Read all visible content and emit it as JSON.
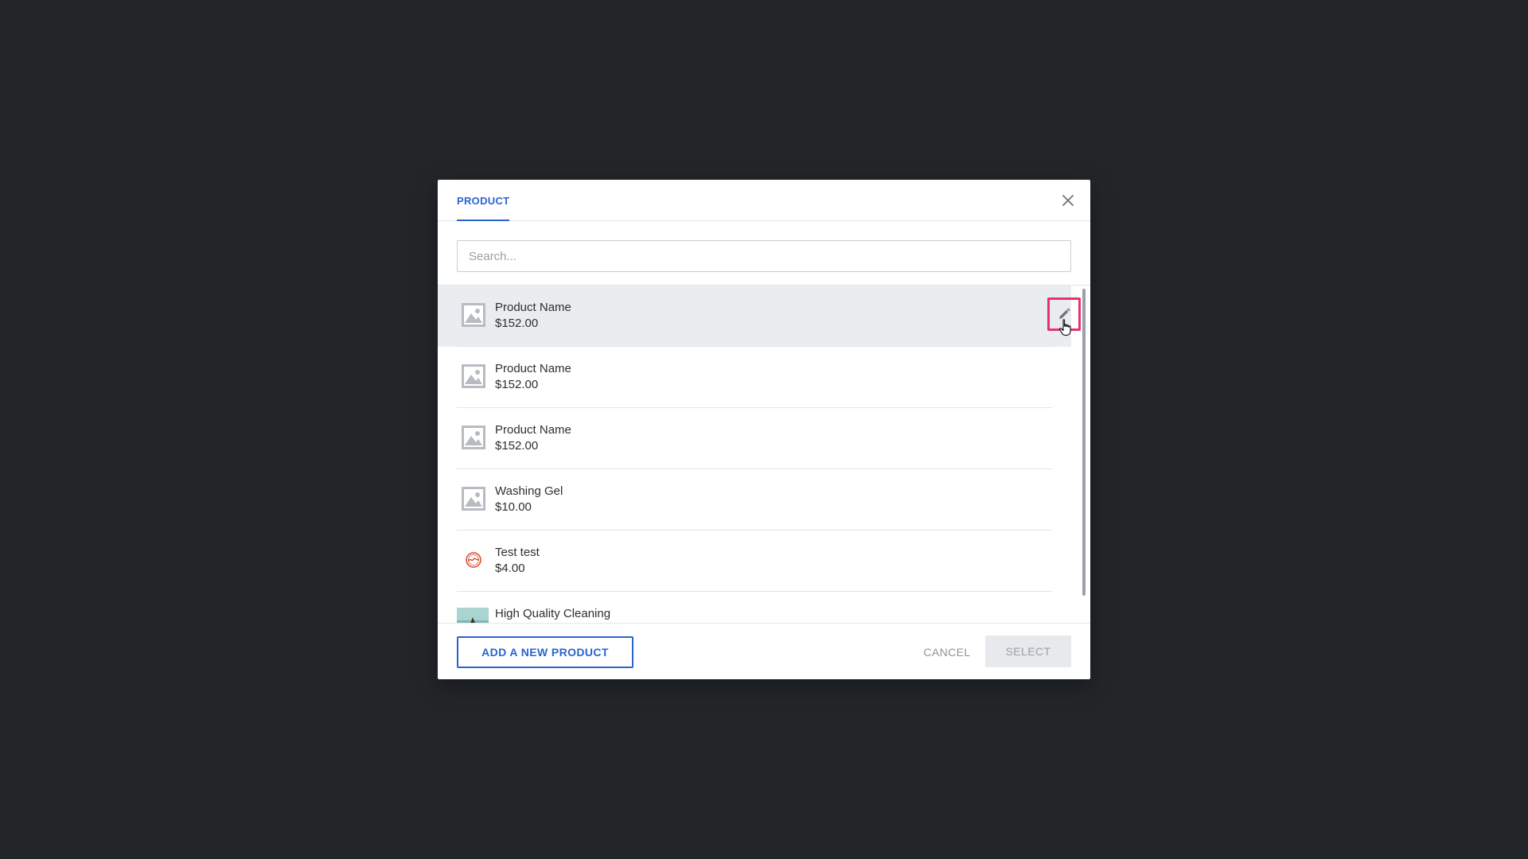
{
  "modal": {
    "tab_label": "PRODUCT",
    "search_placeholder": "Search...",
    "items": [
      {
        "name": "Product Name",
        "price": "$152.00",
        "thumb": "image-placeholder-icon"
      },
      {
        "name": "Product Name",
        "price": "$152.00",
        "thumb": "image-placeholder-icon"
      },
      {
        "name": "Product Name",
        "price": "$152.00",
        "thumb": "image-placeholder-icon"
      },
      {
        "name": "Washing Gel",
        "price": "$10.00",
        "thumb": "image-placeholder-icon"
      },
      {
        "name": "Test test",
        "price": "$4.00",
        "thumb": "logo-stamp-icon"
      },
      {
        "name": "High Quality Cleaning",
        "price": "",
        "thumb": "photo-thumbnail"
      }
    ],
    "footer": {
      "add_label": "ADD A NEW PRODUCT",
      "cancel_label": "CANCEL",
      "select_label": "SELECT"
    }
  },
  "colors": {
    "backdrop": "#232629",
    "accent": "#2a63d1",
    "highlight": "#e8326e",
    "hover_row": "#eaedf0"
  },
  "icons": {
    "close": "close-icon",
    "edit": "pencil-icon",
    "cursor": "hand-pointer-icon"
  }
}
